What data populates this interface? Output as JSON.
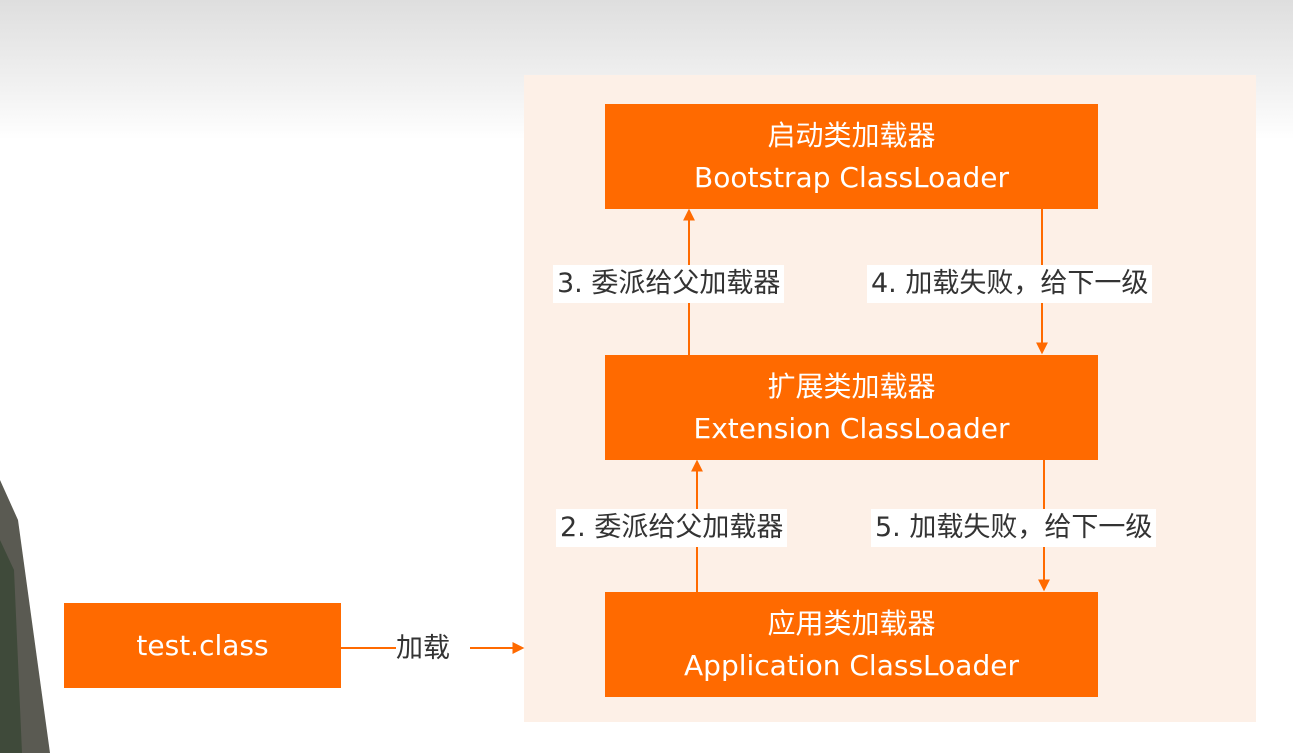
{
  "diagram": {
    "bootstrap": {
      "cn": "启动类加载器",
      "en": "Bootstrap ClassLoader"
    },
    "extension": {
      "cn": "扩展类加载器",
      "en": "Extension ClassLoader"
    },
    "application": {
      "cn": "应用类加载器",
      "en": "Application ClassLoader"
    },
    "source": {
      "label": "test.class"
    },
    "edges": {
      "load": "加载",
      "delegate_2": "2. 委派给父加载器",
      "delegate_3": "3. 委派给父加载器",
      "fail_4": "4. 加载失败，给下一级",
      "fail_5": "5. 加载失败，给下一级"
    }
  },
  "colors": {
    "box": "#ff6a00",
    "arrow": "#ff6a00",
    "panel": "#fdf0e7",
    "text": "#333333"
  }
}
